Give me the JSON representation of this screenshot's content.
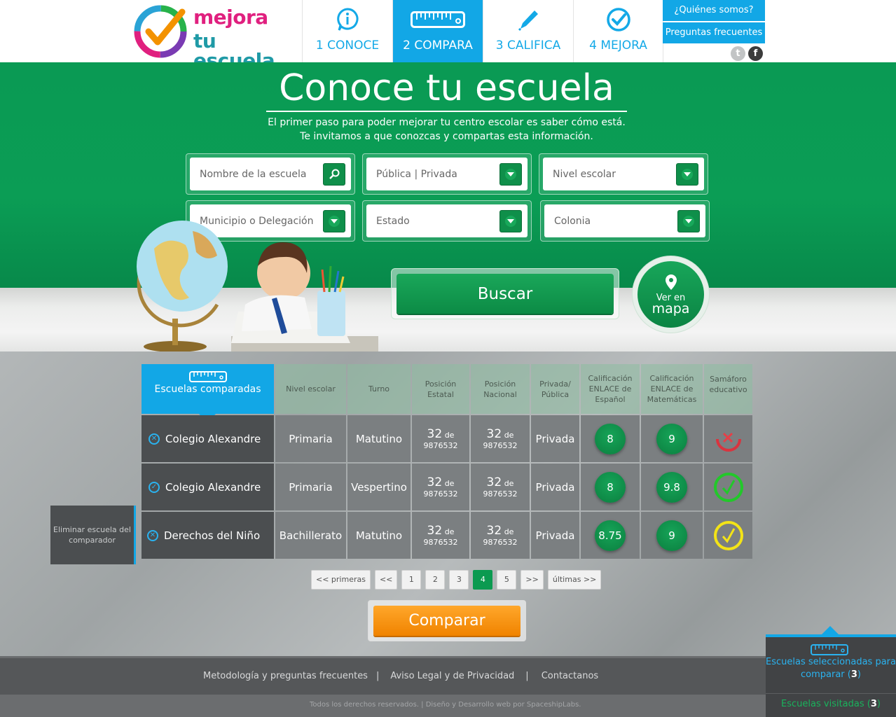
{
  "logo": {
    "line1": "mejora",
    "line2": "tu escuela"
  },
  "nav": [
    {
      "label": "1 CONOCE",
      "icon": "info-icon"
    },
    {
      "label": "2 COMPARA",
      "icon": "ruler-icon"
    },
    {
      "label": "3 CALIFICA",
      "icon": "pencil-icon"
    },
    {
      "label": "4 MEJORA",
      "icon": "check-circle-icon"
    }
  ],
  "side": {
    "quienes": "¿Quiénes somos?",
    "faq": "Preguntas frecuentes"
  },
  "social": {
    "twitter": "t",
    "facebook": "f"
  },
  "hero": {
    "title": "Conoce tu escuela",
    "sub1": "El primer paso para poder mejorar tu centro escolar es saber cómo está.",
    "sub2": "Te invitamos a que conozcas y compartas esta información."
  },
  "filters": {
    "nombre": "Nombre de la escuela",
    "publica": "Pública | Privada",
    "nivel": "Nivel escolar",
    "municipio": "Municipio o Delegación",
    "estado": "Estado",
    "colonia": "Colonia"
  },
  "buttons": {
    "buscar": "Buscar",
    "mapa_small": "Ver en",
    "mapa_big": "mapa",
    "comparar": "Comparar"
  },
  "table": {
    "first_header": "Escuelas comparadas",
    "headers": {
      "nivel": "Nivel escolar",
      "turno": "Turno",
      "pos_est": "Posición Estatal",
      "pos_nac": "Posición Nacional",
      "priv": "Privada/ Pública",
      "esp": "Calificación ENLACE de Español",
      "mat": "Calificación ENLACE de Matemáticas",
      "sem": "Samáforo educativo"
    },
    "rows": [
      {
        "name": "Colegio Alexandre",
        "nivel": "Primaria",
        "turno": "Matutino",
        "pos_est": "32",
        "pos_est_total": "9876532",
        "pos_nac": "32",
        "pos_nac_total": "9876532",
        "priv": "Privada",
        "esp": "8",
        "mat": "9",
        "sem": "red-x",
        "sem_color": "#d9343f"
      },
      {
        "name": "Colegio Alexandre",
        "nivel": "Primaria",
        "turno": "Vespertino",
        "pos_est": "32",
        "pos_est_total": "9876532",
        "pos_nac": "32",
        "pos_nac_total": "9876532",
        "priv": "Privada",
        "esp": "8",
        "mat": "9.8",
        "sem": "green-check",
        "sem_color": "#22c82a"
      },
      {
        "name": "Derechos del Niño",
        "nivel": "Bachillerato",
        "turno": "Matutino",
        "pos_est": "32",
        "pos_est_total": "9876532",
        "pos_nac": "32",
        "pos_nac_total": "9876532",
        "priv": "Privada",
        "esp": "8.75",
        "mat": "9",
        "sem": "yellow-check",
        "sem_color": "#f3e317"
      }
    ],
    "de": "de",
    "remove_tip": "Eliminar escuela del comparador"
  },
  "pager": [
    "<< primeras",
    "<<",
    "1",
    "2",
    "3",
    "4",
    "5",
    ">>",
    "últimas >>"
  ],
  "pager_active": "4",
  "footer": {
    "metodologia": "Metodología y preguntas frecuentes",
    "aviso": "Aviso Legal  y  de Privacidad",
    "contacto": "Contactanos",
    "sep": "|",
    "copy": "Todos los derechos reservados. | Diseño y Desarrollo web por SpaceshipLabs."
  },
  "panel": {
    "seleccionadas": "Escuelas seleccionadas para comparar (",
    "sel_count": "3",
    "visitadas": "Escuelas visitadas (",
    "vis_count": "3",
    "close": ")"
  },
  "colors": {
    "blue": "#12a7e6",
    "green": "#0b9a50",
    "orange": "#f08300"
  }
}
